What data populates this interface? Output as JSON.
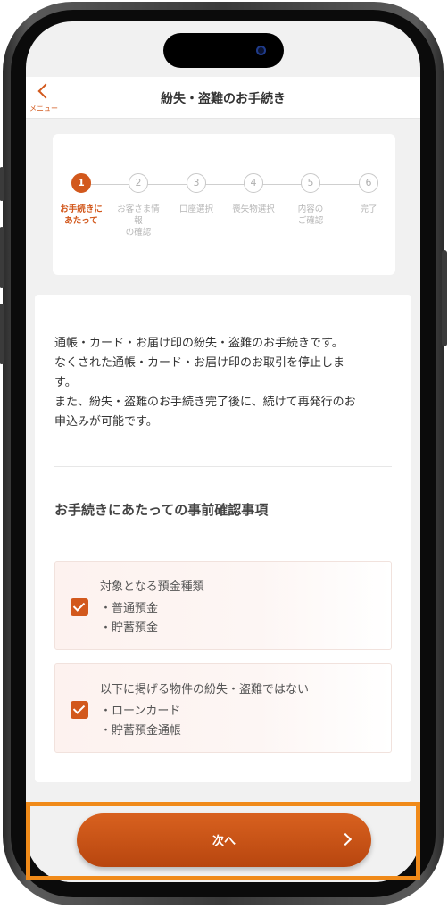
{
  "header": {
    "back_label": "メニュー",
    "title": "紛失・盗難のお手続き"
  },
  "stepper": {
    "steps": [
      {
        "number": "1",
        "label": "お手続きに\nあたって",
        "active": true
      },
      {
        "number": "2",
        "label": "お客さま情\n報\nの確認",
        "active": false
      },
      {
        "number": "3",
        "label": "口座選択",
        "active": false
      },
      {
        "number": "4",
        "label": "喪失物選択",
        "active": false
      },
      {
        "number": "5",
        "label": "内容の\nご確認",
        "active": false
      },
      {
        "number": "6",
        "label": "完了",
        "active": false
      }
    ]
  },
  "intro": {
    "line1": "通帳・カード・お届け印の紛失・盗難のお手続きです。",
    "line2": "なくされた通帳・カード・お届け印のお取引を停止しま",
    "line3": "す。",
    "line4": "また、紛失・盗難のお手続き完了後に、続けて再発行のお",
    "line5": "申込みが可能です。"
  },
  "section_title": "お手続きにあたっての事前確認事項",
  "checks": [
    {
      "title": "対象となる預金種類",
      "items": [
        "・普通預金",
        "・貯蓄預金"
      ],
      "checked": true
    },
    {
      "title": "以下に掲げる物件の紛失・盗難ではない",
      "items": [
        "・ローンカード",
        "・貯蓄預金通帳"
      ],
      "checked": true
    }
  ],
  "next_button": {
    "label": "次へ"
  },
  "colors": {
    "accent": "#d2581c",
    "highlight": "#f08a19"
  }
}
